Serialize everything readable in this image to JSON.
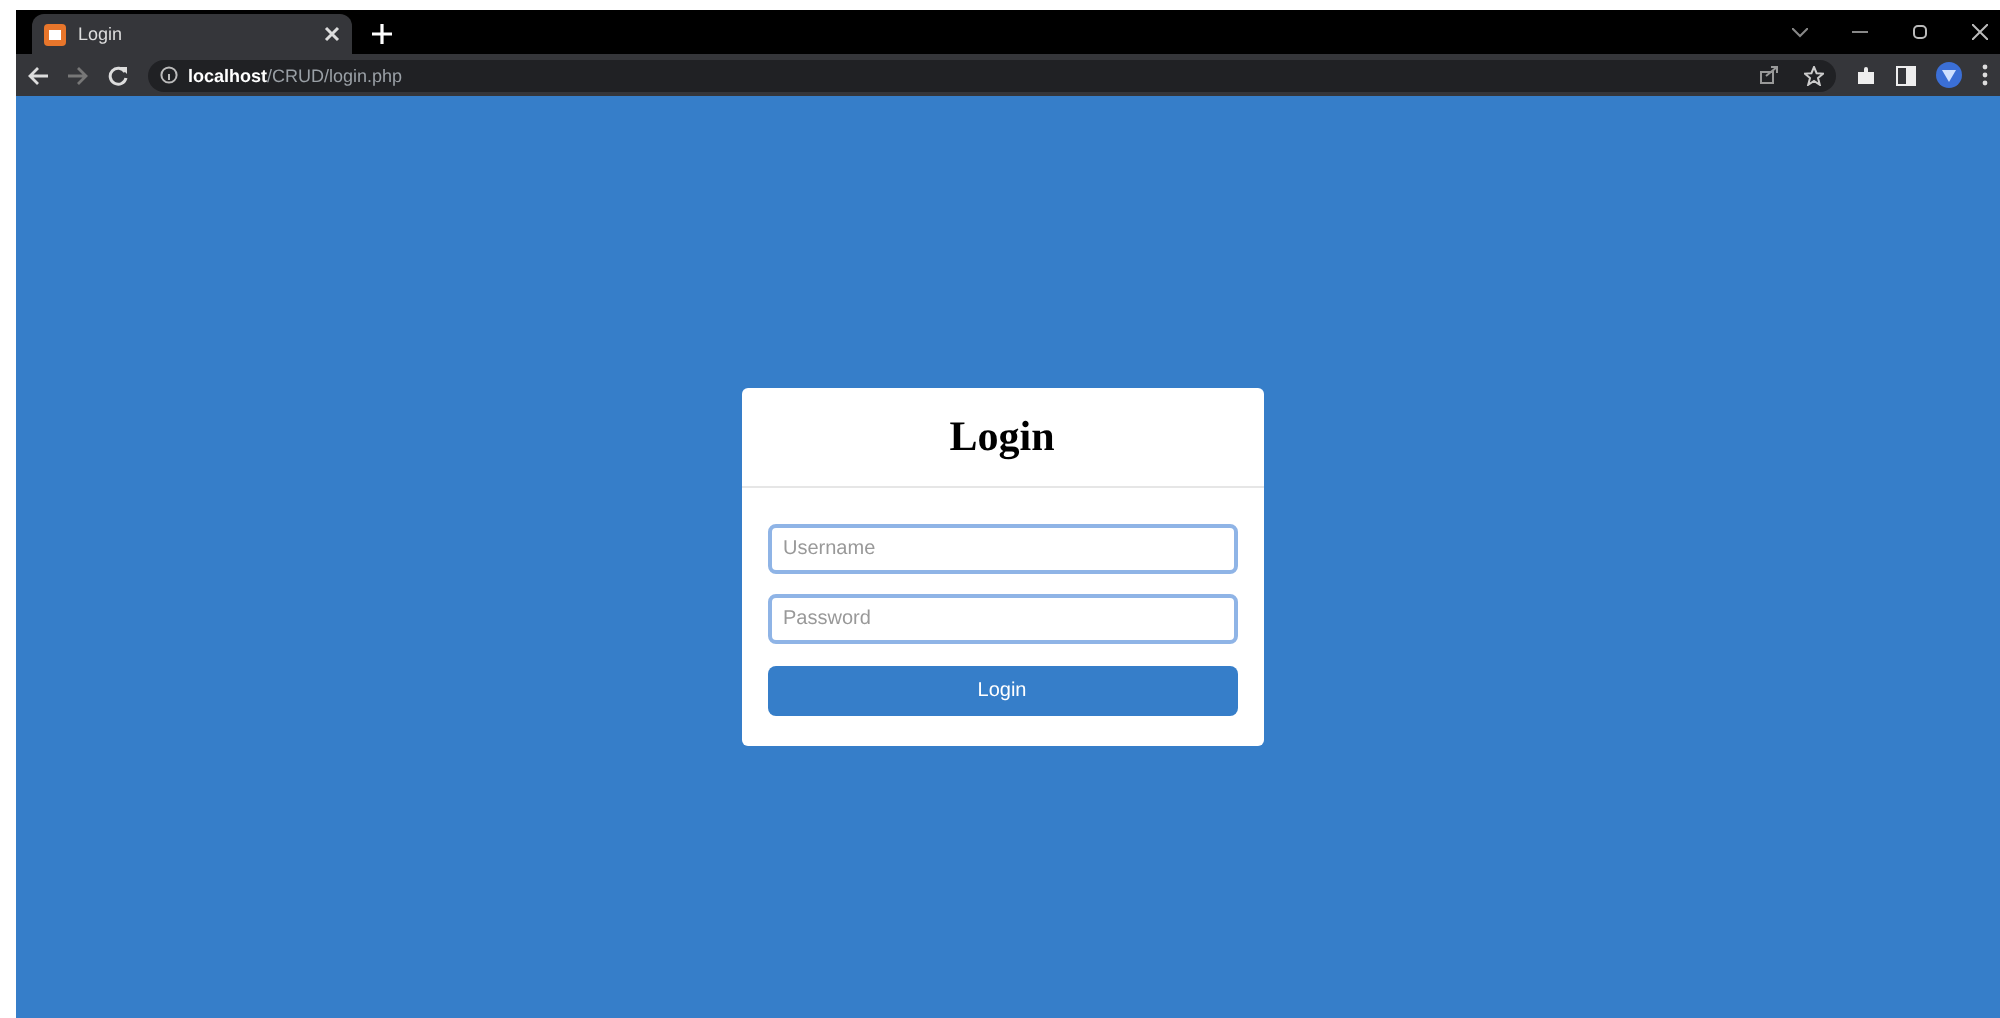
{
  "browser": {
    "tab_title": "Login",
    "url_host": "localhost",
    "url_path": "/CRUD/login.php"
  },
  "login_form": {
    "title": "Login",
    "fields": [
      {
        "placeholder": "Username"
      },
      {
        "placeholder": "Password"
      }
    ],
    "submit": "Login"
  }
}
